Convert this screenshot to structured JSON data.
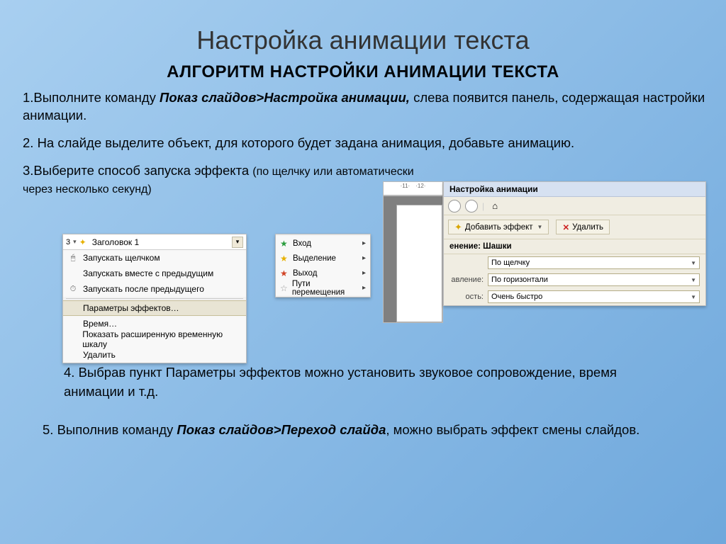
{
  "title": "Настройка анимации текста",
  "subtitle": "АЛГОРИТМ НАСТРОЙКИ АНИМАЦИИ ТЕКСТА",
  "step1_a": "1.Выполните команду ",
  "step1_b": "Показ слайдов>Настройка анимации,",
  "step1_c": " слева появится панель, содержащая настройки анимации.",
  "step2": "2. На слайде выделите объект, для которого будет задана анимация, добавьте анимацию.",
  "step3_a": "3.Выберите способ запуска эффекта ",
  "step3_b": "(по щелчку или автоматически через несколько секунд)",
  "step4": "4. Выбрав пункт Параметры эффектов можно установить звуковое сопровождение,  время анимации и т.д.",
  "step5_a": "5. Выполнив команду ",
  "step5_b": "Показ слайдов>Переход слайда",
  "step5_c": ", можно выбрать эффект смены слайдов.",
  "panel1": {
    "num": "3",
    "triangle": "▾",
    "header": "Заголовок 1",
    "items": [
      "Запускать щелчком",
      "Запускать вместе с предыдущим",
      "Запускать после предыдущего"
    ],
    "selected": "Параметры эффектов…",
    "items2": [
      "Время…",
      "Показать расширенную временную шкалу",
      "Удалить"
    ]
  },
  "panel2": {
    "items": [
      {
        "star": "green",
        "label": "Вход"
      },
      {
        "star": "yellow",
        "label": "Выделение"
      },
      {
        "star": "red",
        "label": "Выход"
      },
      {
        "star": "grey",
        "label": "Пути перемещения"
      }
    ]
  },
  "panel3": {
    "title": "Настройка анимации",
    "add": "Добавить эффект",
    "del": "Удалить",
    "section": "енение: Шашки",
    "fields": [
      {
        "lbl": "",
        "val": "По щелчку"
      },
      {
        "lbl": "авление:",
        "val": "По горизонтали"
      },
      {
        "lbl": "ость:",
        "val": "Очень быстро"
      }
    ]
  },
  "ruler": {
    "a": "·11·",
    "b": "·12·"
  }
}
